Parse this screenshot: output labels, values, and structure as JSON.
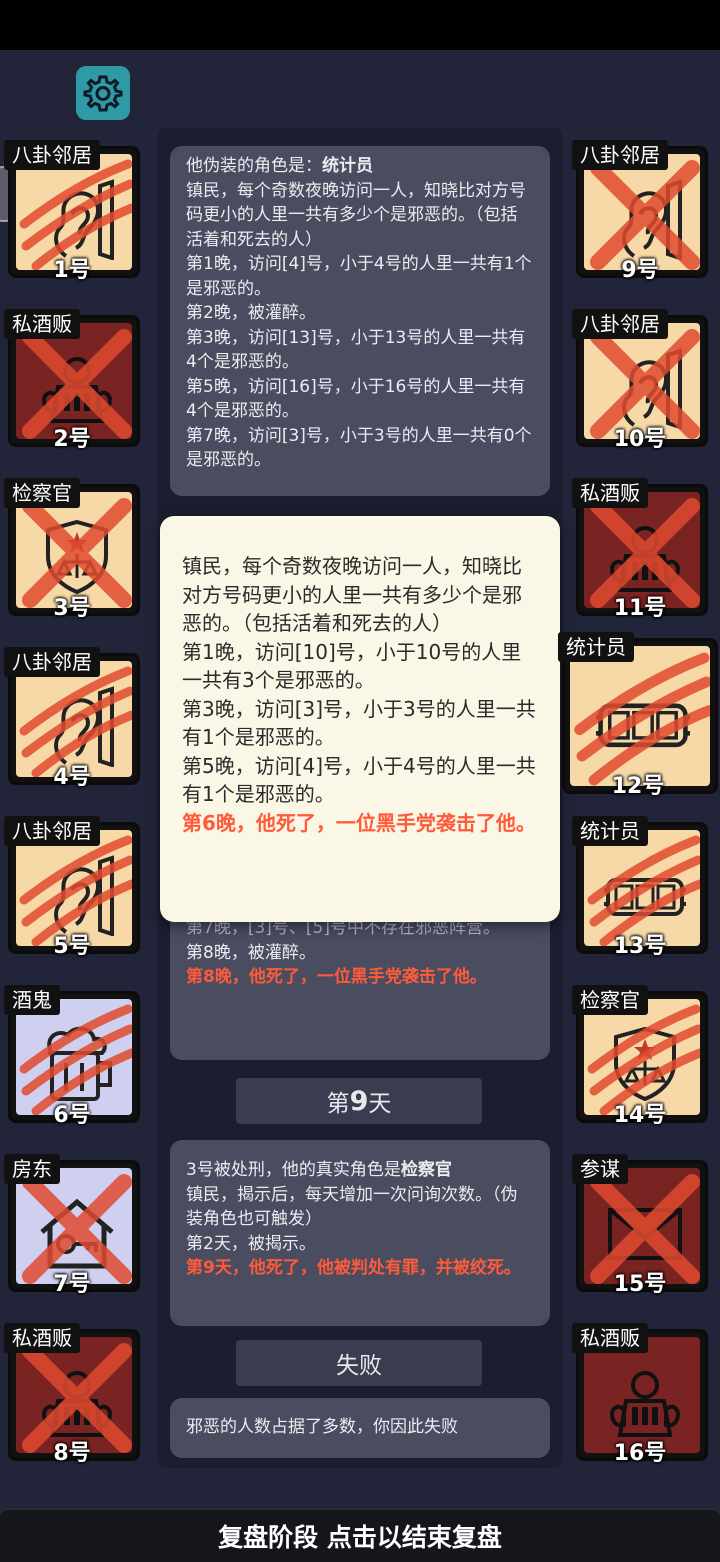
{
  "settings": {
    "icon": "gear-icon"
  },
  "players_left": [
    {
      "role": "八卦邻居",
      "number": "1号",
      "bg": "#f6d9a6",
      "icon": "ear-icon",
      "status": "claw"
    },
    {
      "role": "私酒贩",
      "number": "2号",
      "bg": "#7a2323",
      "icon": "smuggler-icon",
      "status": "cross"
    },
    {
      "role": "检察官",
      "number": "3号",
      "bg": "#f6d9a6",
      "icon": "prosecutor-badge-icon",
      "status": "cross"
    },
    {
      "role": "八卦邻居",
      "number": "4号",
      "bg": "#f6d9a6",
      "icon": "ear-icon",
      "status": "claw"
    },
    {
      "role": "八卦邻居",
      "number": "5号",
      "bg": "#f6d9a6",
      "icon": "ear-icon",
      "status": "claw"
    },
    {
      "role": "酒鬼",
      "number": "6号",
      "bg": "#cfcff0",
      "icon": "beer-mug-icon",
      "status": "claw"
    },
    {
      "role": "房东",
      "number": "7号",
      "bg": "#cfcff0",
      "icon": "house-key-icon",
      "status": "cross"
    },
    {
      "role": "私酒贩",
      "number": "8号",
      "bg": "#7a2323",
      "icon": "smuggler-icon",
      "status": "cross"
    }
  ],
  "players_right": [
    {
      "role": "八卦邻居",
      "number": "9号",
      "bg": "#f6d9a6",
      "icon": "ear-icon",
      "status": "cross"
    },
    {
      "role": "八卦邻居",
      "number": "10号",
      "bg": "#f6d9a6",
      "icon": "ear-icon",
      "status": "cross"
    },
    {
      "role": "私酒贩",
      "number": "11号",
      "bg": "#7a2323",
      "icon": "smuggler-icon",
      "status": "cross"
    },
    {
      "role": "统计员",
      "number": "12号",
      "bg": "#f6d9a6",
      "icon": "counter-icon",
      "status": "claw"
    },
    {
      "role": "统计员",
      "number": "13号",
      "bg": "#f6d9a6",
      "icon": "counter-icon",
      "status": "claw"
    },
    {
      "role": "检察官",
      "number": "14号",
      "bg": "#f6d9a6",
      "icon": "prosecutor-badge-icon",
      "status": "claw"
    },
    {
      "role": "参谋",
      "number": "15号",
      "bg": "#7a2323",
      "icon": "envelope-icon",
      "status": "cross"
    },
    {
      "role": "私酒贩",
      "number": "16号",
      "bg": "#7a2323",
      "icon": "smuggler-icon",
      "status": "alive"
    }
  ],
  "log_top": {
    "disguise_prefix": "他伪装的角色是：",
    "disguise_role": "统计员",
    "desc": "镇民，每个奇数夜晚访问一人，知晓比对方号码更小的人里一共有多少个是邪恶的。（包括活着和死去的人）",
    "lines": [
      "第1晚，访问[4]号，小于4号的人里一共有1个是邪恶的。",
      "第2晚，被灌醉。",
      "第3晚，访问[13]号，小于13号的人里一共有4个是邪恶的。",
      "第5晚，访问[16]号，小于16号的人里一共有4个是邪恶的。",
      "第7晚，访问[3]号，小于3号的人里一共有0个是邪恶的。"
    ]
  },
  "log_mid": {
    "partial": "第7晚，[3]号、[5]号中不存在邪恶阵营。",
    "line": "第8晚，被灌醉。",
    "death": "第8晚，他死了，一位黑手党袭击了他。"
  },
  "day9": {
    "prefix": "第",
    "num": "9",
    "suffix": "天"
  },
  "log_day9": {
    "executed_prefix": "3号被处刑，他的真实角色是",
    "executed_role": "检察官",
    "desc": "镇民，揭示后，每天增加一次问询次数。（伪装角色也可触发）",
    "line": "第2天，被揭示。",
    "death": "第9天，他死了，他被判处有罪，并被绞死。"
  },
  "result": {
    "label": "失败",
    "text": "邪恶的人数占据了多数，你因此失败"
  },
  "popup": {
    "desc": "镇民，每个奇数夜晚访问一人，知晓比对方号码更小的人里一共有多少个是邪恶的。（包括活着和死去的人）",
    "lines": [
      "第1晚，访问[10]号，小于10号的人里一共有3个是邪恶的。",
      "第3晚，访问[3]号，小于3号的人里一共有1个是邪恶的。",
      "第5晚，访问[4]号，小于4号的人里一共有1个是邪恶的。"
    ],
    "death": "第6晚，他死了，一位黑手党袭击了他。"
  },
  "bottom_bar": {
    "text": "复盘阶段 点击以结束复盘"
  },
  "colors": {
    "kill": "#e04a2f",
    "evil_bg": "#7a2323",
    "villager_bg": "#f6d9a6",
    "outsider_bg": "#cfcff0"
  }
}
